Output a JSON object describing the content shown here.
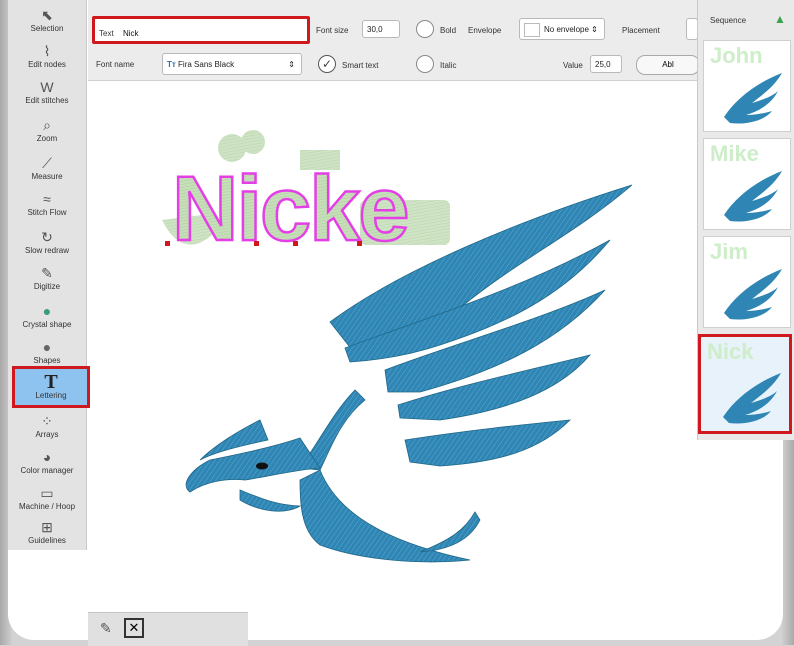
{
  "colors": {
    "accent_highlight": "#d0181f",
    "stitch_blue": "#2f86b4",
    "stitch_light_green": "#c6dfb9",
    "outline_magenta": "#e43fe6"
  },
  "toolbar": {
    "items": [
      {
        "label": "Selection",
        "icon": "selection-icon",
        "glyph": "⬉"
      },
      {
        "label": "Edit nodes",
        "icon": "edit-nodes-icon",
        "glyph": "⌇"
      },
      {
        "label": "Edit stitches",
        "icon": "edit-stitches-icon",
        "glyph": "W"
      },
      {
        "label": "Zoom",
        "icon": "zoom-icon",
        "glyph": "⌕"
      },
      {
        "label": "Measure",
        "icon": "measure-icon",
        "glyph": "⟋"
      },
      {
        "label": "Stitch Flow",
        "icon": "stitch-flow-icon",
        "glyph": "≈"
      },
      {
        "label": "Slow redraw",
        "icon": "slow-redraw-icon",
        "glyph": "↻"
      },
      {
        "label": "Digitize",
        "icon": "digitize-icon",
        "glyph": "✎"
      },
      {
        "label": "Crystal shape",
        "icon": "crystal-shape-icon",
        "glyph": "●"
      },
      {
        "label": "Shapes",
        "icon": "shapes-icon",
        "glyph": "●"
      },
      {
        "label": "Lettering",
        "icon": "lettering-icon",
        "glyph": "T"
      },
      {
        "label": "Arrays",
        "icon": "arrays-icon",
        "glyph": "⁘"
      },
      {
        "label": "Color manager",
        "icon": "color-manager-icon",
        "glyph": "◕"
      },
      {
        "label": "Machine / Hoop",
        "icon": "hoop-icon",
        "glyph": "▭"
      },
      {
        "label": "Guidelines",
        "icon": "guidelines-icon",
        "glyph": "⊞"
      }
    ]
  },
  "properties": {
    "text_label": "Text",
    "text_value": "Nick",
    "font_size_label": "Font size",
    "font_size_value": "30,0",
    "bold_label": "Bold",
    "envelope_label": "Envelope",
    "envelope_value": "No envelope",
    "placement_label": "Placement",
    "font_name_label": "Font name",
    "font_name_value": "Fira Sans Black",
    "smart_text_label": "Smart text",
    "italic_label": "Italic",
    "value_label": "Value",
    "value_value": "25,0",
    "button_partial": "Abl"
  },
  "sequence": {
    "title": "Sequence",
    "items": [
      {
        "name": "John"
      },
      {
        "name": "Mike"
      },
      {
        "name": "Jim"
      },
      {
        "name": "Nick",
        "selected": true
      }
    ]
  },
  "design": {
    "lettering_text": "Nicke"
  }
}
